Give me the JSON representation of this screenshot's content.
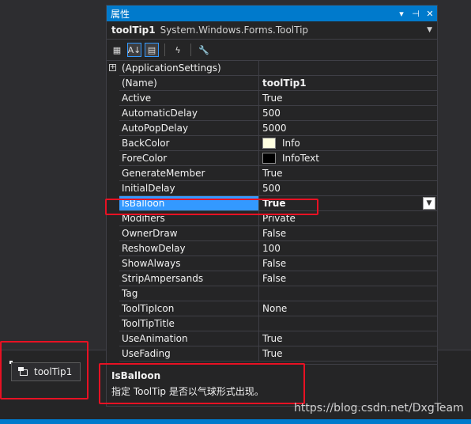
{
  "window_title": "属性",
  "object_selector": {
    "name": "toolTip1",
    "type": "System.Windows.Forms.ToolTip"
  },
  "toolbar": {
    "buttons": [
      {
        "icon": "categorized-icon",
        "glyph": "▦",
        "active": false
      },
      {
        "icon": "alphabetical-icon",
        "glyph": "A↓",
        "active": true
      },
      {
        "icon": "properties-icon",
        "glyph": "▤",
        "active": true
      },
      {
        "icon": "events-icon",
        "glyph": "ϟ",
        "active": false
      },
      {
        "icon": "property-pages-icon",
        "glyph": "🔧",
        "active": false
      }
    ]
  },
  "properties": [
    {
      "name": "(ApplicationSettings)",
      "value": "",
      "expandable": true
    },
    {
      "name": "(Name)",
      "value": "toolTip1",
      "bold": true
    },
    {
      "name": "Active",
      "value": "True"
    },
    {
      "name": "AutomaticDelay",
      "value": "500"
    },
    {
      "name": "AutoPopDelay",
      "value": "5000"
    },
    {
      "name": "BackColor",
      "value": "Info",
      "swatch": "#ffffe1"
    },
    {
      "name": "ForeColor",
      "value": "InfoText",
      "swatch": "#000000"
    },
    {
      "name": "GenerateMember",
      "value": "True"
    },
    {
      "name": "InitialDelay",
      "value": "500"
    },
    {
      "name": "IsBalloon",
      "value": "True",
      "selected": true
    },
    {
      "name": "Modifiers",
      "value": "Private"
    },
    {
      "name": "OwnerDraw",
      "value": "False"
    },
    {
      "name": "ReshowDelay",
      "value": "100"
    },
    {
      "name": "ShowAlways",
      "value": "False"
    },
    {
      "name": "StripAmpersands",
      "value": "False"
    },
    {
      "name": "Tag",
      "value": ""
    },
    {
      "name": "ToolTipIcon",
      "value": "None"
    },
    {
      "name": "ToolTipTitle",
      "value": ""
    },
    {
      "name": "UseAnimation",
      "value": "True"
    },
    {
      "name": "UseFading",
      "value": "True"
    }
  ],
  "description": {
    "title": "IsBalloon",
    "text": "指定 ToolTip 是否以气球形式出现。"
  },
  "tray": {
    "component_label": "toolTip1"
  },
  "watermark": "https://blog.csdn.net/DxgTeam",
  "colors": {
    "accent": "#007acc",
    "selection": "#3399ff",
    "highlight_box": "#e81123"
  }
}
